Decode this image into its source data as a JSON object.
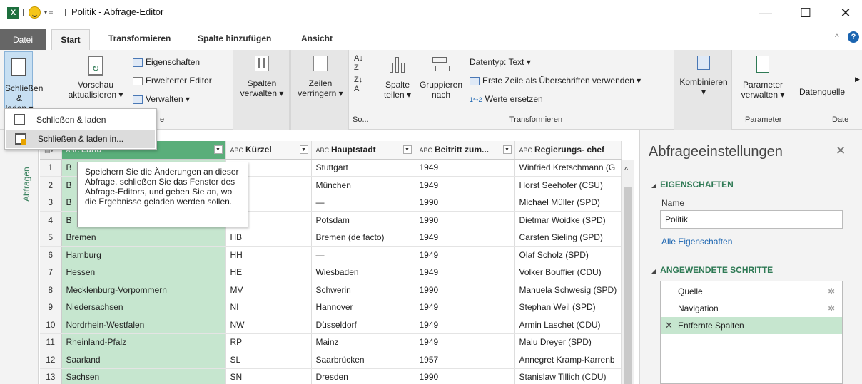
{
  "titlebar": {
    "app_icon": "excel-icon",
    "title": "Politik - Abfrage-Editor",
    "separator": "|",
    "minimize": "—",
    "maximize": "☐",
    "close": "✕"
  },
  "tabs": {
    "datei": "Datei",
    "start": "Start",
    "transformieren": "Transformieren",
    "spalte_hinzufuegen": "Spalte hinzufügen",
    "ansicht": "Ansicht"
  },
  "ribbon": {
    "schliessen_laden": {
      "line1": "Schließen",
      "line2": "& laden ▾"
    },
    "vorschau": {
      "line1": "Vorschau",
      "line2": "aktualisieren ▾"
    },
    "eigenschaften": "Eigenschaften",
    "erweiterter_editor": "Erweiterter Editor",
    "verwalten": "Verwalten ▾",
    "abfrage_group_label_tail": "e",
    "spalten_verwalten": {
      "line1": "Spalten",
      "line2": "verwalten ▾"
    },
    "zeilen_verringern": {
      "line1": "Zeilen",
      "line2": "verringern ▾"
    },
    "sort_group_label": "So...",
    "spalte_teilen": {
      "line1": "Spalte",
      "line2": "teilen ▾"
    },
    "gruppieren_nach": {
      "line1": "Gruppieren",
      "line2": "nach"
    },
    "datentyp": "Datentyp: Text ▾",
    "erste_zeile": "Erste Zeile als Überschriften verwenden ▾",
    "werte_ersetzen": "Werte ersetzen",
    "transformieren_label": "Transformieren",
    "kombinieren": {
      "line1": "Kombinieren",
      "line2": "▾"
    },
    "parameter_verwalten": {
      "line1": "Parameter",
      "line2": "verwalten ▾"
    },
    "parameter_label": "Parameter",
    "datenquelle": "Datenquelle",
    "date_label": "Date"
  },
  "dropdown": {
    "item1": "Schließen & laden",
    "item2": "Schließen & laden in..."
  },
  "tooltip": "Speichern Sie die Änderungen an dieser Abfrage, schließen Sie das Fenster des Abfrage-Editors, und geben Sie an, wo die Ergebnisse geladen werden sollen.",
  "leftstrip": {
    "label": "Abfragen"
  },
  "table": {
    "headers": [
      "Land",
      "Kürzel",
      "Hauptstadt",
      "Beitritt zum...",
      "Regierungs- chef"
    ],
    "type_badge": "A B C",
    "rows": [
      {
        "n": "1",
        "land": "B",
        "kuerzel": "",
        "hauptstadt": "Stuttgart",
        "beitritt": "1949",
        "chef": "Winfried Kretschmann (G"
      },
      {
        "n": "2",
        "land": "B",
        "kuerzel": "",
        "hauptstadt": "München",
        "beitritt": "1949",
        "chef": "Horst Seehofer (CSU)"
      },
      {
        "n": "3",
        "land": "B",
        "kuerzel": "",
        "hauptstadt": "—",
        "beitritt": "1990",
        "chef": "Michael Müller (SPD)"
      },
      {
        "n": "4",
        "land": "B",
        "kuerzel": "",
        "hauptstadt": "Potsdam",
        "beitritt": "1990",
        "chef": "Dietmar Woidke (SPD)"
      },
      {
        "n": "5",
        "land": "Bremen",
        "kuerzel": "HB",
        "hauptstadt": "Bremen (de facto)",
        "beitritt": "1949",
        "chef": "Carsten Sieling (SPD)"
      },
      {
        "n": "6",
        "land": "Hamburg",
        "kuerzel": "HH",
        "hauptstadt": "—",
        "beitritt": "1949",
        "chef": "Olaf Scholz (SPD)"
      },
      {
        "n": "7",
        "land": "Hessen",
        "kuerzel": "HE",
        "hauptstadt": "Wiesbaden",
        "beitritt": "1949",
        "chef": "Volker Bouffier (CDU)"
      },
      {
        "n": "8",
        "land": "Mecklenburg-Vorpommern",
        "kuerzel": "MV",
        "hauptstadt": "Schwerin",
        "beitritt": "1990",
        "chef": "Manuela Schwesig (SPD)"
      },
      {
        "n": "9",
        "land": "Niedersachsen",
        "kuerzel": "NI",
        "hauptstadt": "Hannover",
        "beitritt": "1949",
        "chef": "Stephan Weil (SPD)"
      },
      {
        "n": "10",
        "land": "Nordrhein-Westfalen",
        "kuerzel": "NW",
        "hauptstadt": "Düsseldorf",
        "beitritt": "1949",
        "chef": "Armin Laschet (CDU)"
      },
      {
        "n": "11",
        "land": "Rheinland-Pfalz",
        "kuerzel": "RP",
        "hauptstadt": "Mainz",
        "beitritt": "1949",
        "chef": "Malu Dreyer (SPD)"
      },
      {
        "n": "12",
        "land": "Saarland",
        "kuerzel": "SL",
        "hauptstadt": "Saarbrücken",
        "beitritt": "1957",
        "chef": "Annegret Kramp-Karrenb"
      },
      {
        "n": "13",
        "land": "Sachsen",
        "kuerzel": "SN",
        "hauptstadt": "Dresden",
        "beitritt": "1990",
        "chef": "Stanislaw Tillich (CDU)"
      }
    ]
  },
  "rightpane": {
    "title": "Abfrageeinstellungen",
    "close": "✕",
    "eigenschaften_head": "EIGENSCHAFTEN",
    "name_label": "Name",
    "name_value": "Politik",
    "alle_link": "Alle Eigenschaften",
    "schritte_head": "ANGEWENDETE SCHRITTE",
    "steps": [
      "Quelle",
      "Navigation",
      "Entfernte Spalten"
    ]
  },
  "colors": {
    "accent_green": "#2f7a55",
    "selected_column": "#c6e6cf",
    "selected_header": "#5aae7a",
    "selected_step": "#c6e6cf"
  }
}
